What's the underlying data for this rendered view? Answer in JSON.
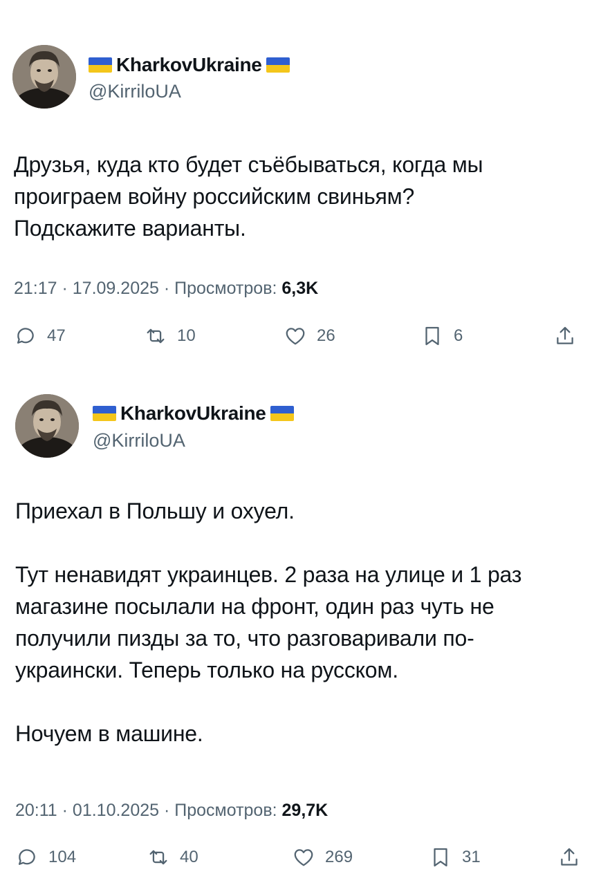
{
  "tweets": [
    {
      "display_name": "KharkovUkraine",
      "handle": "@KirriloUA",
      "text": "Друзья, куда кто будет съёбываться, когда мы\nпроиграем войну российским свиньям?\nПодскажите варианты.",
      "meta_prefix": "21:17 · 17.09.2025 · Просмотров: ",
      "views": "6,3K",
      "counts": {
        "replies": "47",
        "retweets": "10",
        "likes": "26",
        "bookmarks": "6"
      }
    },
    {
      "display_name": "KharkovUkraine",
      "handle": "@KirriloUA",
      "text": "Приехал в Польшу и охуел.\n\nТут ненавидят украинцев. 2 раза на улице и 1 раз\nмагазине посылали на фронт, один раз чуть не\nполучили пизды за то, что разговаривали по-\nукраински. Теперь только на русском.\n\nНочуем в машине.",
      "meta_prefix": "20:11 · 01.10.2025 · Просмотров: ",
      "views": "29,7K",
      "counts": {
        "replies": "104",
        "retweets": "40",
        "likes": "269",
        "bookmarks": "31"
      }
    }
  ],
  "icons": {
    "reply": "speech-bubble-icon",
    "retweet": "retweet-arrows-icon",
    "like": "heart-icon",
    "bookmark": "bookmark-icon",
    "share": "share-upload-icon",
    "flag": "ukraine-flag-icon"
  },
  "colors": {
    "text": "#0f1419",
    "secondary": "#536471",
    "flag_blue": "#2f5fd0",
    "flag_yellow": "#f4c61b"
  }
}
